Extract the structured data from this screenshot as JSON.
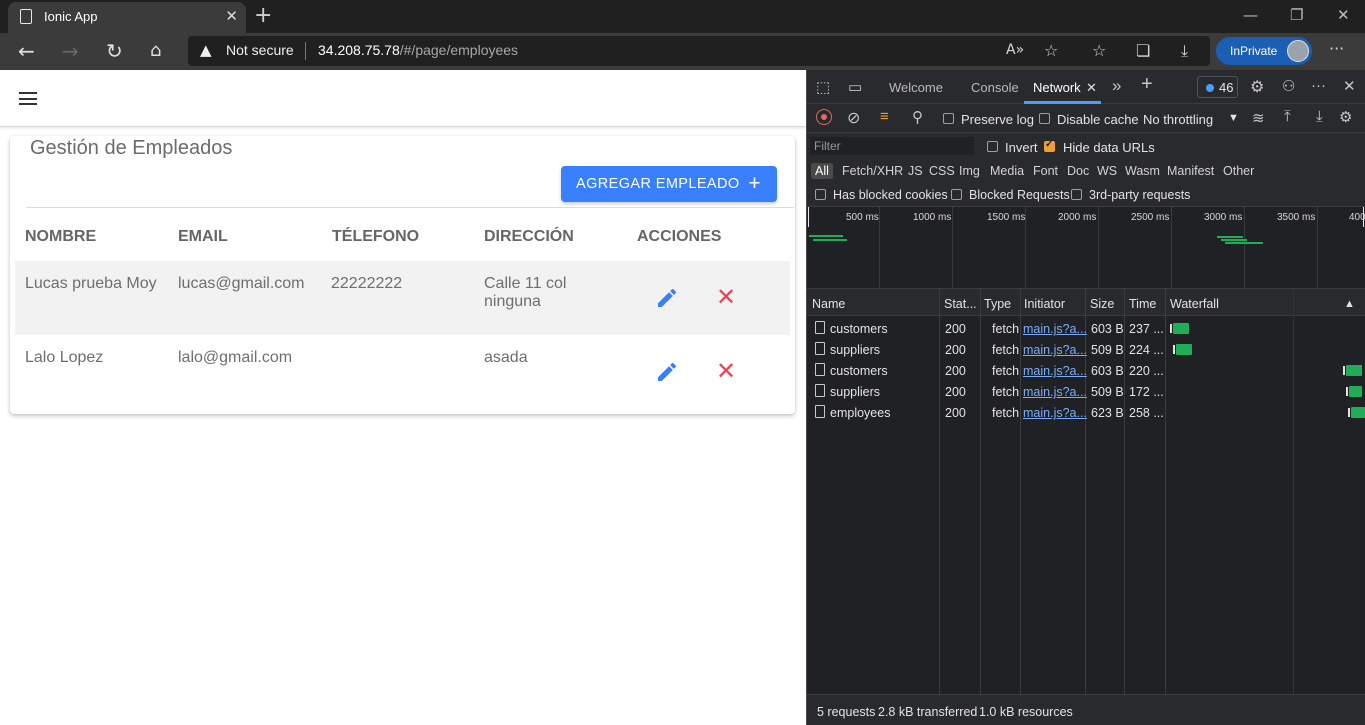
{
  "browser": {
    "tab_title": "Ionic App",
    "tab_close": "✕",
    "new_tab": "+",
    "security_label": "Not secure",
    "url_host": "34.208.75.78",
    "url_path": "/#/page/employees",
    "inprivate_label": "InPrivate",
    "more": "···"
  },
  "app": {
    "card_title": "Gestión de Empleados",
    "add_button_label": "AGREGAR EMPLEADO",
    "add_button_icon": "+",
    "columns": [
      "NOMBRE",
      "EMAIL",
      "TÉLEFONO",
      "DIRECCIÓN",
      "ACCIONES"
    ],
    "employees": [
      {
        "nombre": "Lucas prueba Moy",
        "email": "lucas@gmail.com",
        "telefono": "22222222",
        "direccion_line1": "Calle 11 col",
        "direccion_line2": "ninguna"
      },
      {
        "nombre": "Lalo Lopez",
        "email": "lalo@gmail.com",
        "telefono": "",
        "direccion_line1": "asada",
        "direccion_line2": ""
      }
    ],
    "delete_glyph": "✕",
    "row_highlight_color": "#f2f2f2",
    "accent_color": "#3880ff",
    "danger_color": "#eb445a"
  },
  "devtools": {
    "tabs": [
      "Welcome",
      "Console",
      "Network"
    ],
    "active_tab": "Network",
    "tab_close": "✕",
    "more_tabs": "»",
    "add_tab": "+",
    "issues_count": "46",
    "more": "···",
    "close": "✕",
    "toolbar": {
      "preserve_log": "Preserve log",
      "disable_cache": "Disable cache",
      "throttling": "No throttling",
      "throttling_caret": "▼"
    },
    "filter": {
      "placeholder": "Filter",
      "invert": "Invert",
      "hide_data_urls": "Hide data URLs",
      "types": [
        "All",
        "Fetch/XHR",
        "JS",
        "CSS",
        "Img",
        "Media",
        "Font",
        "Doc",
        "WS",
        "Wasm",
        "Manifest",
        "Other"
      ],
      "has_blocked_cookies": "Has blocked cookies",
      "blocked_requests": "Blocked Requests",
      "third_party": "3rd-party requests"
    },
    "overview_ticks": [
      "500 ms",
      "1000 ms",
      "1500 ms",
      "2000 ms",
      "2500 ms",
      "3000 ms",
      "3500 ms",
      "400"
    ],
    "columns": [
      "Name",
      "Stat...",
      "Type",
      "Initiator",
      "Size",
      "Time",
      "Waterfall"
    ],
    "sort_glyph": "▲",
    "requests": [
      {
        "name": "customers",
        "status": "200",
        "type": "fetch",
        "initiator": "main.js?a...",
        "size": "603 B",
        "time": "237 ..."
      },
      {
        "name": "suppliers",
        "status": "200",
        "type": "fetch",
        "initiator": "main.js?a...",
        "size": "509 B",
        "time": "224 ..."
      },
      {
        "name": "customers",
        "status": "200",
        "type": "fetch",
        "initiator": "main.js?a...",
        "size": "603 B",
        "time": "220 ..."
      },
      {
        "name": "suppliers",
        "status": "200",
        "type": "fetch",
        "initiator": "main.js?a...",
        "size": "509 B",
        "time": "172 ..."
      },
      {
        "name": "employees",
        "status": "200",
        "type": "fetch",
        "initiator": "main.js?a...",
        "size": "623 B",
        "time": "258 ..."
      }
    ],
    "status": {
      "requests": "5 requests",
      "transferred": "2.8 kB transferred",
      "resources": "1.0 kB resources"
    }
  }
}
